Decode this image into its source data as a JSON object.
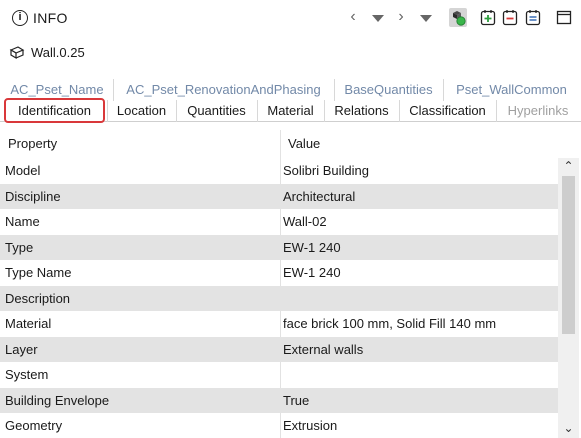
{
  "header": {
    "title": "INFO",
    "icons": {
      "info": "info-circle-icon",
      "nav_prev": "chevron-left-icon",
      "nav_prev_menu": "triangle-down-icon",
      "nav_next": "chevron-right-icon",
      "nav_next_menu": "triangle-down-icon",
      "tools": [
        "highlight-objects-icon",
        "add-icon",
        "remove-icon",
        "clipboard-icon",
        "maximize-icon"
      ]
    }
  },
  "selection": {
    "icon": "wall-icon",
    "label": "Wall.0.25"
  },
  "tabs": {
    "back_row": [
      "AC_Pset_Name",
      "AC_Pset_RenovationAndPhasing",
      "BaseQuantities",
      "Pset_WallCommon"
    ],
    "front_row": [
      "Identification",
      "Location",
      "Quantities",
      "Material",
      "Relations",
      "Classification",
      "Hyperlinks"
    ],
    "selected": "Identification"
  },
  "table": {
    "columns": [
      "Property",
      "Value"
    ],
    "rows": [
      {
        "property": "Model",
        "value": "Solibri Building"
      },
      {
        "property": "Discipline",
        "value": "Architectural"
      },
      {
        "property": "Name",
        "value": "Wall-02"
      },
      {
        "property": "Type",
        "value": "EW-1 240"
      },
      {
        "property": "Type Name",
        "value": "EW-1 240"
      },
      {
        "property": "Description",
        "value": ""
      },
      {
        "property": "Material",
        "value": "face brick 100 mm, Solid Fill 140 mm"
      },
      {
        "property": "Layer",
        "value": "External walls"
      },
      {
        "property": "System",
        "value": ""
      },
      {
        "property": "Building Envelope",
        "value": "True"
      },
      {
        "property": "Geometry",
        "value": "Extrusion"
      }
    ]
  },
  "colors": {
    "selected_tab_border": "#d9383a",
    "alt_row": "#e3e3e3",
    "back_tab_text": "#7289a8",
    "highlight_green": "#39b54a"
  }
}
